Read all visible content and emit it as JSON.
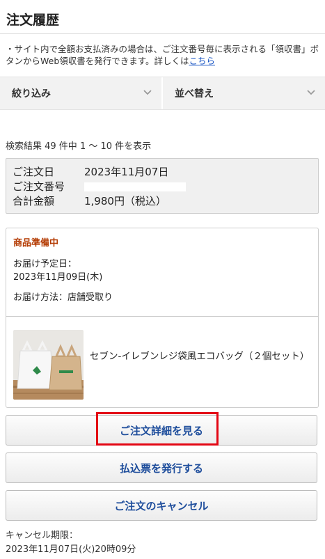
{
  "header": {
    "title": "注文履歴"
  },
  "notice": {
    "text": "・サイト内で全額お支払済みの場合は、ご注文番号毎に表示される「領収書」ボタンからWeb領収書を発行できます。詳しくは",
    "link": "こちら"
  },
  "filterbar": {
    "filter_label": "絞り込み",
    "sort_label": "並べ替え"
  },
  "results": {
    "count_text": "検索結果 49 件中 1 〜 10 件を表示"
  },
  "order_summary": {
    "date_label": "ご注文日",
    "date_value": "2023年11月07日",
    "number_label": "ご注文番号",
    "total_label": "合計金額",
    "total_value": "1,980円（税込）"
  },
  "order": {
    "status": "商品準備中",
    "delivery_date_label": "お届け予定日：",
    "delivery_date_value": "2023年11月09日(木)",
    "delivery_method": "お届け方法：店舗受取り",
    "product_name": "セブン-イレブンレジ袋風エコバッグ（２個セット）"
  },
  "buttons": {
    "details": "ご注文詳細を見る",
    "payment_slip": "払込票を発行する",
    "cancel": "ご注文のキャンセル"
  },
  "cancel_deadline": {
    "label": "キャンセル期限：",
    "value": "2023年11月07日(火)20時09分"
  },
  "colors": {
    "link": "#1a56c4",
    "button_text": "#1f4e9c",
    "status": "#b33a00",
    "highlight": "#e30613"
  }
}
